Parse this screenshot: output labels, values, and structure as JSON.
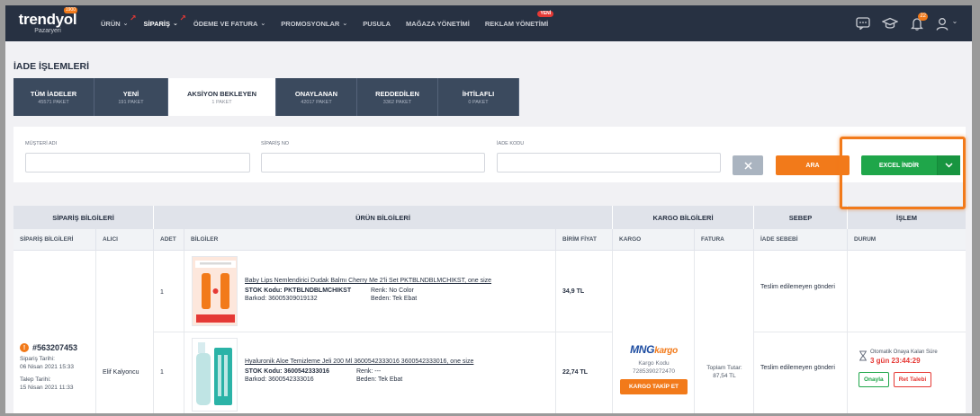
{
  "brand": {
    "name": "trendyol",
    "sub": "Pazaryeri",
    "badge": "1900"
  },
  "nav": {
    "items": [
      {
        "label": "ÜRÜN"
      },
      {
        "label": "SİPARİŞ"
      },
      {
        "label": "ÖDEME VE FATURA"
      },
      {
        "label": "PROMOSYONLAR"
      },
      {
        "label": "PUSULA"
      },
      {
        "label": "MAĞAZA YÖNETİMİ"
      },
      {
        "label": "REKLAM YÖNETİMİ",
        "badge": "YENİ"
      }
    ],
    "notification_count": "22"
  },
  "page": {
    "title": "İADE İŞLEMLERİ"
  },
  "tabs": [
    {
      "label": "TÜM İADELER",
      "count": "45571 PAKET"
    },
    {
      "label": "YENİ",
      "count": "191 PAKET"
    },
    {
      "label": "AKSİYON BEKLEYEN",
      "count": "1 PAKET"
    },
    {
      "label": "ONAYLANAN",
      "count": "42017 PAKET"
    },
    {
      "label": "REDDEDİLEN",
      "count": "3362 PAKET"
    },
    {
      "label": "İHTİLAFLI",
      "count": "0 PAKET"
    }
  ],
  "filters": {
    "customer_label": "MÜŞTERİ ADI",
    "order_label": "SİPARİŞ NO",
    "return_label": "İADE KODU",
    "search_button": "ARA",
    "excel_button": "EXCEL İNDİR"
  },
  "table": {
    "groups": [
      "SİPARİŞ BİLGİLERİ",
      "ÜRÜN BİLGİLERİ",
      "KARGO BİLGİLERİ",
      "SEBEP",
      "İŞLEM"
    ],
    "columns": [
      "SİPARİŞ BİLGİLERİ",
      "ALICI",
      "ADET",
      "BİLGİLER",
      "BİRİM FİYAT",
      "KARGO",
      "FATURA",
      "İADE SEBEBİ",
      "DURUM"
    ],
    "order": {
      "number": "#563207453",
      "order_date_label": "Sipariş Tarihi:",
      "order_date": "06 Nisan 2021 15:33",
      "request_date_label": "Talep Tarihi:",
      "request_date": "15 Nisan 2021 11:33",
      "buyer": "Elif Kalyoncu"
    },
    "products": [
      {
        "qty": "1",
        "title": "Baby Lips Nemlendirici Dudak Balmı Cherry Me 2'li Set PKTBLNDBLMCHIKST, one size",
        "stock_label": "STOK Kodu:",
        "stock": "PKTBLNDBLMCHIKST",
        "barcode_label": "Barkod:",
        "barcode": "3600530901913​2",
        "color_label": "Renk:",
        "color": "No Color",
        "size_label": "Beden:",
        "size": "Tek Ebat",
        "price": "34,9 TL",
        "reason": "Teslim edilemeyen gönderi"
      },
      {
        "qty": "1",
        "title": "Hyaluronik Aloe Temizleme Jeli 200 Ml 3600542333016 3600542333016, one size",
        "stock_label": "STOK Kodu:",
        "stock": "3600542333016",
        "barcode_label": "Barkod:",
        "barcode": "3600542333016",
        "color_label": "Renk:",
        "color": "---",
        "size_label": "Beden:",
        "size": "Tek Ebat",
        "price": "22,74 TL",
        "reason": "Teslim edilemeyen gönderi"
      }
    ],
    "cargo": {
      "carrier_main": "MNG",
      "carrier_suffix": "kargo",
      "code_label": "Kargo Kodu",
      "code": "7285390272470",
      "track_button": "KARGO TAKİP ET"
    },
    "invoice": {
      "total_label": "Toplam Tutar:",
      "total": "87,54 TL"
    },
    "status": {
      "timer_label": "Otomatik Onaya Kalan Süre",
      "timer": "3 gün 23:44:29",
      "approve_button": "Onayla",
      "reject_button": "Ret Talebi"
    }
  },
  "colors": {
    "nav_bg": "#273142",
    "accent": "#f27a1a",
    "success": "#1fa64a",
    "danger": "#e53935"
  }
}
